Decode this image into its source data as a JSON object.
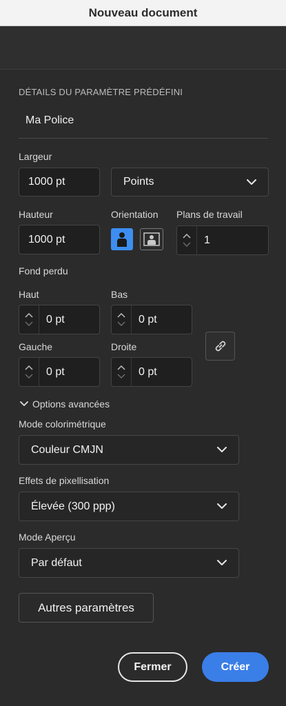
{
  "window": {
    "title": "Nouveau document"
  },
  "preset": {
    "section_header": "DÉTAILS DU PARAMÈTRE PRÉDÉFINI",
    "name": "Ma Police"
  },
  "size": {
    "width_label": "Largeur",
    "width_value": "1000 pt",
    "units_value": "Points",
    "height_label": "Hauteur",
    "height_value": "1000 pt",
    "orientation_label": "Orientation",
    "orientation_selected": "portrait",
    "artboards_label": "Plans de travail",
    "artboards_value": "1"
  },
  "bleed": {
    "label": "Fond perdu",
    "top_label": "Haut",
    "top_value": "0 pt",
    "bottom_label": "Bas",
    "bottom_value": "0 pt",
    "left_label": "Gauche",
    "left_value": "0 pt",
    "right_label": "Droite",
    "right_value": "0 pt",
    "link_icon": "link-icon"
  },
  "advanced": {
    "toggle_label": "Options avancées",
    "color_mode_label": "Mode colorimétrique",
    "color_mode_value": "Couleur CMJN",
    "raster_label": "Effets de pixellisation",
    "raster_value": "Élevée (300 ppp)",
    "preview_label": "Mode Aperçu",
    "preview_value": "Par défaut",
    "more_settings": "Autres paramètres"
  },
  "actions": {
    "close": "Fermer",
    "create": "Créer"
  },
  "colors": {
    "accent": "#3a7ee8",
    "portrait_selected": "#3d8ef0",
    "panel_bg": "#2b2b2b",
    "field_bg": "#1f1f1f"
  }
}
